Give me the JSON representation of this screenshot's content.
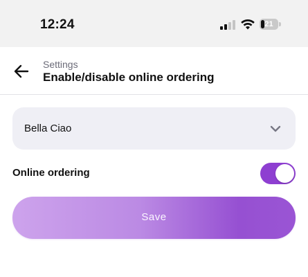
{
  "status_bar": {
    "time": "12:24",
    "battery_level": "21",
    "battery_fraction": 0.21
  },
  "header": {
    "breadcrumb": "Settings",
    "title": "Enable/disable online ordering"
  },
  "restaurant_select": {
    "selected": "Bella Ciao",
    "icon": "chevron-down-icon"
  },
  "online_ordering": {
    "label": "Online ordering",
    "enabled": true,
    "color": "#8e3fd1"
  },
  "save_button": {
    "label": "Save",
    "gradient_start": "#cda3ec",
    "gradient_end": "#9650d2"
  },
  "icons": {
    "back": "arrow-left-icon",
    "signal": "cellular-signal-icon",
    "wifi": "wifi-icon",
    "battery": "battery-icon"
  }
}
